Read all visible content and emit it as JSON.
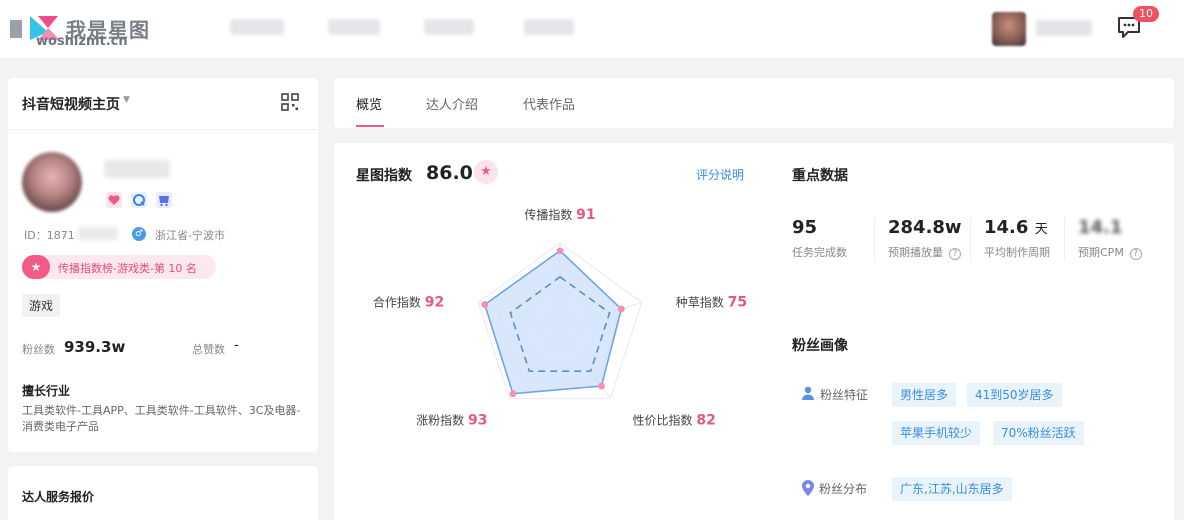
{
  "brand": {
    "name": "我是星图",
    "url": "woshizmt.cn"
  },
  "header": {
    "message_badge": "10"
  },
  "profile": {
    "page_selector": "抖音短视频主页",
    "id_prefix": "ID：1871",
    "location": "浙江省-宁波市",
    "rank": "传播指数榜-游戏类-第 10 名",
    "category_tag": "游戏",
    "fans_label": "粉丝数",
    "fans_value": "939.3w",
    "likes_label": "总赞数",
    "likes_value": "-",
    "industry_title": "擅长行业",
    "industry_text": "工具类软件-工具APP、工具类软件-工具软件、3C及电器-消费类电子产品",
    "service_title": "达人服务报价"
  },
  "tabs": [
    "概览",
    "达人介绍",
    "代表作品"
  ],
  "score": {
    "title": "星图指数",
    "value": "86.0",
    "link": "评分说明"
  },
  "radar": {
    "axes": [
      {
        "label": "传播指数",
        "value": 91
      },
      {
        "label": "种草指数",
        "value": 75
      },
      {
        "label": "性价比指数",
        "value": 82
      },
      {
        "label": "涨粉指数",
        "value": 93
      },
      {
        "label": "合作指数",
        "value": 92
      }
    ],
    "colors": {
      "fill": "#cfe1fb",
      "line": "#6fa2ea",
      "dashed": "#5f8bc9",
      "point": "#f48fb0",
      "value": "#e8587c"
    }
  },
  "key_data": {
    "title": "重点数据",
    "stats": [
      {
        "value": "95",
        "unit": "",
        "label": "任务完成数",
        "help": false
      },
      {
        "value": "284.8w",
        "unit": "",
        "label": "预期播放量",
        "help": true
      },
      {
        "value": "14.6",
        "unit": "天",
        "label": "平均制作周期",
        "help": false
      },
      {
        "value": "14.1",
        "unit": "",
        "label": "预期CPM",
        "help": true
      }
    ]
  },
  "fans_profile": {
    "title": "粉丝画像",
    "features_label": "粉丝特征",
    "features": [
      "男性居多",
      "41到50岁居多",
      "苹果手机较少",
      "70%粉丝活跃"
    ],
    "distribution_label": "粉丝分布",
    "distribution": [
      "广东,江苏,山东居多"
    ]
  }
}
